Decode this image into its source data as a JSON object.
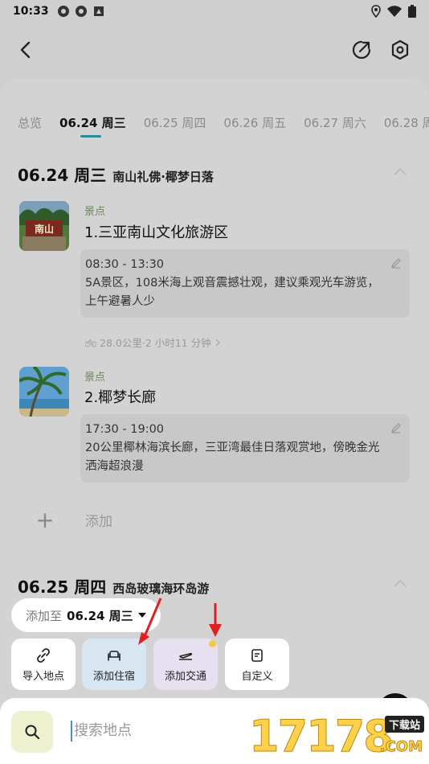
{
  "status_bar": {
    "time": "10:33"
  },
  "header": {
    "back_icon": "back-icon",
    "share_icon": "share-icon",
    "settings_icon": "settings-icon"
  },
  "tabs": [
    {
      "label": "总览"
    },
    {
      "label": "06.24 周三"
    },
    {
      "label": "06.25 周四"
    },
    {
      "label": "06.26 周五"
    },
    {
      "label": "06.27 周六"
    },
    {
      "label": "06.28 周"
    }
  ],
  "days": [
    {
      "date": "06.24 周三",
      "theme": "南山礼佛·椰梦日落",
      "places": [
        {
          "category": "景点",
          "name": "1.三亚南山文化旅游区",
          "thumb_text": "南山",
          "time": "08:30 - 13:30",
          "desc": "5A景区，108米海上观音震撼壮观，建议乘观光车游览，上午避暑人少"
        },
        {
          "category": "景点",
          "name": "2.椰梦长廊",
          "time": "17:30 - 19:00",
          "desc": "20公里椰林海滨长廊，三亚湾最佳日落观赏地，傍晚金光洒海超浪漫"
        }
      ],
      "route": "28.0公里·2 小时11 分钟",
      "add_label": "添加"
    },
    {
      "date": "06.25 周四",
      "theme": "西岛玻璃海环岛游"
    }
  ],
  "add_to": {
    "prefix": "添加至",
    "date": "06.24 周三"
  },
  "quick_actions": [
    {
      "label": "导入地点",
      "icon": "link-icon"
    },
    {
      "label": "添加住宿",
      "icon": "bed-icon"
    },
    {
      "label": "添加交通",
      "icon": "plane-icon"
    },
    {
      "label": "自定义",
      "icon": "note-icon"
    }
  ],
  "search": {
    "placeholder": "搜索地点"
  },
  "watermark": {
    "number": "17178",
    "tag": "下载站",
    "suffix": ".COM"
  },
  "colors": {
    "accent": "#2a8a99",
    "category_green": "#6a8a55",
    "arrow_red": "#e02020",
    "dot_yellow": "#f7c948"
  }
}
